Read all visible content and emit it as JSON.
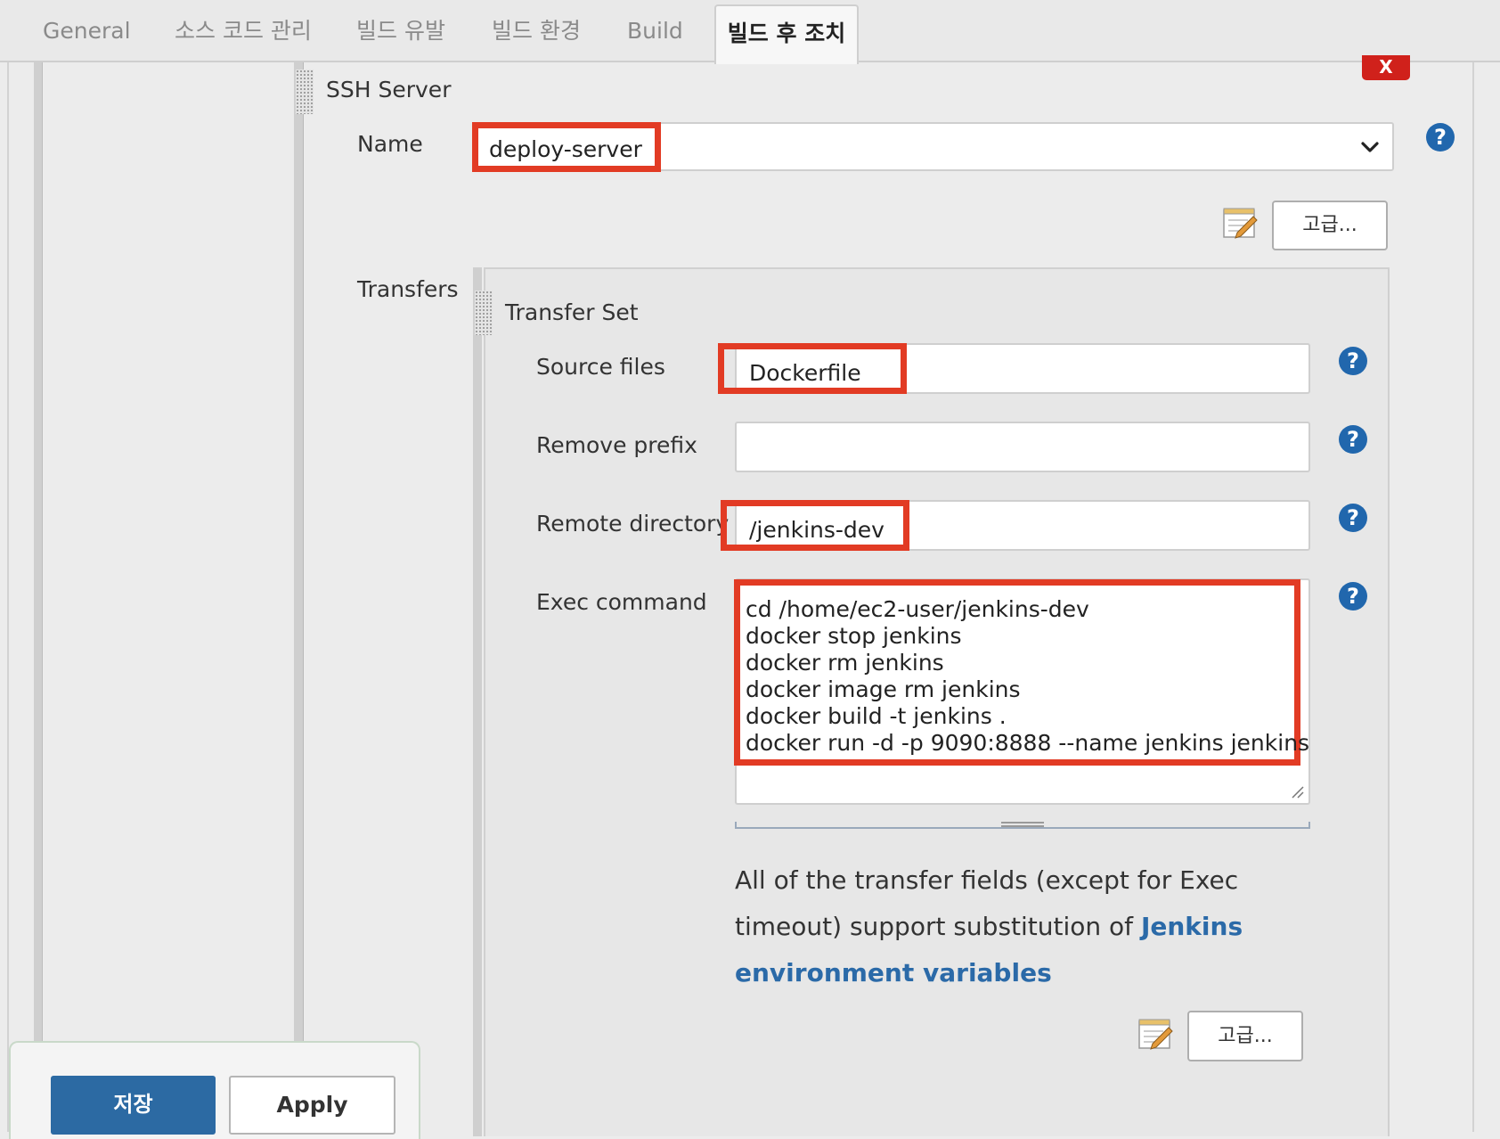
{
  "tabs": [
    {
      "label": "General"
    },
    {
      "label": "소스 코드 관리"
    },
    {
      "label": "빌드 유발"
    },
    {
      "label": "빌드 환경"
    },
    {
      "label": "Build"
    },
    {
      "label": "빌드 후 조치"
    }
  ],
  "ssh_server": {
    "title": "SSH Server",
    "close_label": "X",
    "name_label": "Name",
    "name_value": "deploy-server",
    "advanced_label": "고급..."
  },
  "transfers": {
    "label": "Transfers",
    "set_title": "Transfer Set",
    "source_files_label": "Source files",
    "source_files_value": "Dockerfile",
    "remove_prefix_label": "Remove prefix",
    "remove_prefix_value": "",
    "remote_directory_label": "Remote directory",
    "remote_directory_value": "/jenkins-dev",
    "exec_command_label": "Exec command",
    "exec_command_value": "cd /home/ec2-user/jenkins-dev\ndocker stop jenkins\ndocker rm jenkins\ndocker image rm jenkins\ndocker build -t jenkins .\ndocker run -d -p 9090:8888 --name jenkins jenkins",
    "desc_line1": "All of the transfer fields (except for Exec",
    "desc_line2": "timeout) support substitution of ",
    "desc_link_1": "Jenkins",
    "desc_link_2": "environment variables",
    "advanced_label": "고급..."
  },
  "help_icon_glyph": "?",
  "footer": {
    "save_label": "저장",
    "apply_label": "Apply"
  },
  "colors": {
    "highlight": "#e23b24",
    "help": "#2167ad",
    "save": "#2c6aa3",
    "link": "#2b6aa8"
  }
}
